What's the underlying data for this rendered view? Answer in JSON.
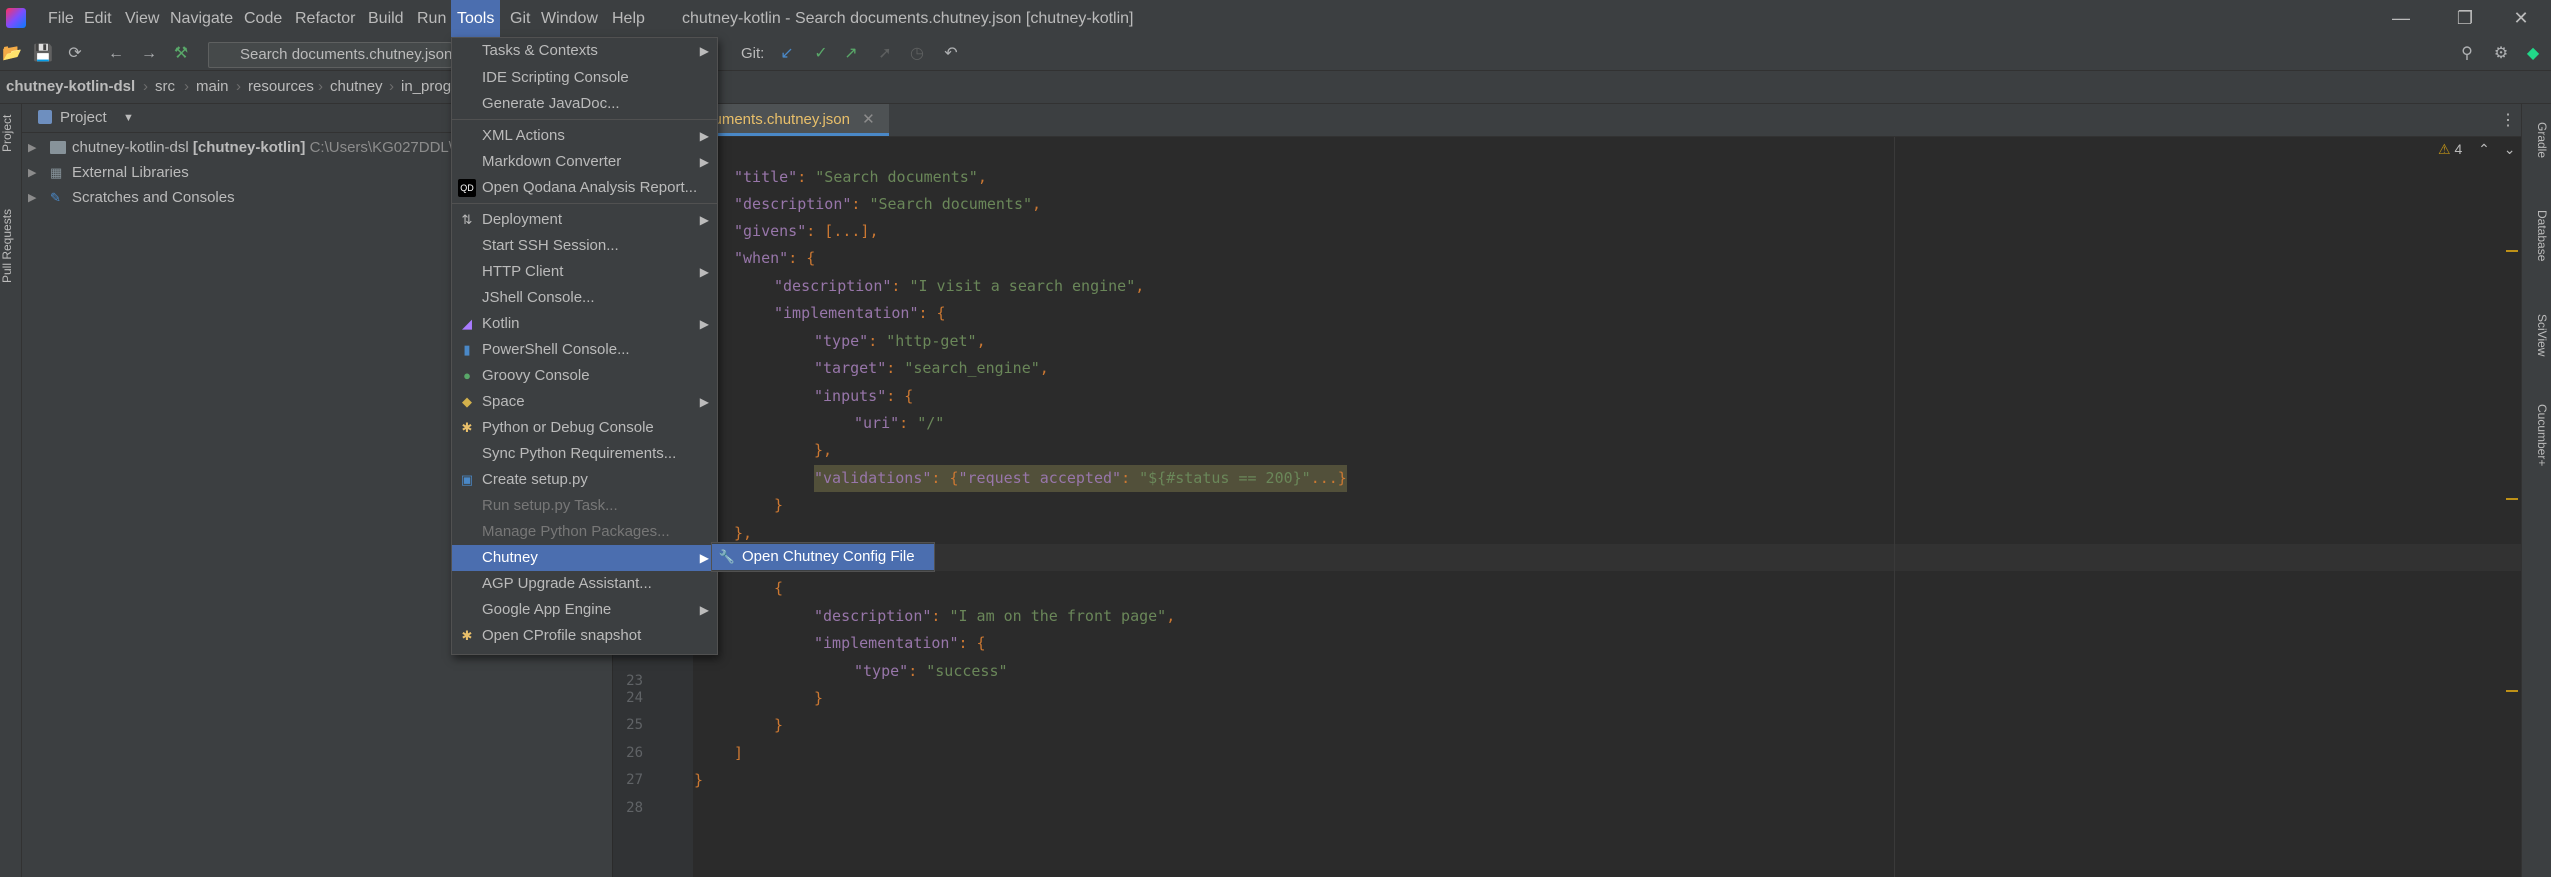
{
  "window": {
    "title": "chutney-kotlin - Search documents.chutney.json [chutney-kotlin]",
    "controls": [
      "—",
      "❐",
      "✕"
    ]
  },
  "menubar": {
    "items": [
      "File",
      "Edit",
      "View",
      "Navigate",
      "Code",
      "Refactor",
      "Build",
      "Run",
      "Tools",
      "Git",
      "Window",
      "Help"
    ],
    "active": "Tools"
  },
  "toolbar": {
    "search_text": "Search documents.chutney.json",
    "git_label": "Git:"
  },
  "breadcrumb": [
    "chutney-kotlin-dsl",
    "src",
    "main",
    "resources",
    "chutney",
    "in_prog"
  ],
  "project": {
    "header": "Project",
    "tree": [
      {
        "label": "chutney-kotlin-dsl",
        "bold_suffix": "[chutney-kotlin]",
        "path": "C:\\Users\\KG027DDL\\"
      },
      {
        "label": "External Libraries"
      },
      {
        "label": "Scratches and Consoles"
      }
    ]
  },
  "left_stripe": [
    "Project",
    "Pull Requests"
  ],
  "right_stripe": [
    "Gradle",
    "Database",
    "SciView",
    "Cucumber+"
  ],
  "editor": {
    "tab": "cuments.chutney.json",
    "warnings": "4",
    "lines": [
      {
        "n": "",
        "text": "\"title\": \"Search documents\","
      },
      {
        "n": "",
        "text": "\"description\": \"Search documents\","
      },
      {
        "n": "",
        "text": "\"givens\": [...],"
      },
      {
        "n": "",
        "text": "\"when\": {"
      },
      {
        "n": "",
        "text": "\"description\": \"I visit a search engine\","
      },
      {
        "n": "",
        "text": "\"implementation\": {"
      },
      {
        "n": "",
        "text": "\"type\": \"http-get\","
      },
      {
        "n": "",
        "text": "\"target\": \"search_engine\","
      },
      {
        "n": "",
        "text": "\"inputs\": {"
      },
      {
        "n": "",
        "text": "\"uri\": \"/\""
      },
      {
        "n": "",
        "text": "},"
      },
      {
        "n": "",
        "text": "\"validations\": {\"request accepted\": \"${#status == 200}\"...}"
      },
      {
        "n": "",
        "text": "}"
      },
      {
        "n": "",
        "text": "},"
      },
      {
        "n": "",
        "text": ""
      },
      {
        "n": "",
        "text": "{"
      },
      {
        "n": "",
        "text": "\"description\": \"I am on the front page\","
      },
      {
        "n": "",
        "text": "\"implementation\": {"
      },
      {
        "n": "23",
        "text": "\"type\": \"success\""
      },
      {
        "n": "24",
        "text": "}"
      },
      {
        "n": "25",
        "text": "}"
      },
      {
        "n": "26",
        "text": "]"
      },
      {
        "n": "27",
        "text": "}"
      },
      {
        "n": "28",
        "text": ""
      }
    ]
  },
  "tools_menu": {
    "items": [
      {
        "label": "Tasks & Contexts",
        "submenu": true
      },
      {
        "label": "IDE Scripting Console"
      },
      {
        "label": "Generate JavaDoc..."
      },
      {
        "label": "XML Actions",
        "submenu": true
      },
      {
        "label": "Markdown Converter",
        "submenu": true
      },
      {
        "label": "Open Qodana Analysis Report..."
      },
      {
        "label": "Deployment",
        "submenu": true
      },
      {
        "label": "Start SSH Session..."
      },
      {
        "label": "HTTP Client",
        "submenu": true
      },
      {
        "label": "JShell Console..."
      },
      {
        "label": "Kotlin",
        "submenu": true
      },
      {
        "label": "PowerShell Console..."
      },
      {
        "label": "Groovy Console"
      },
      {
        "label": "Space",
        "submenu": true
      },
      {
        "label": "Python or Debug Console"
      },
      {
        "label": "Sync Python Requirements..."
      },
      {
        "label": "Create setup.py"
      },
      {
        "label": "Run setup.py Task..."
      },
      {
        "label": "Manage Python Packages..."
      },
      {
        "label": "Chutney",
        "submenu": true
      },
      {
        "label": "AGP Upgrade Assistant..."
      },
      {
        "label": "Google App Engine",
        "submenu": true
      },
      {
        "label": "Open CProfile snapshot"
      }
    ]
  },
  "chutney_submenu": {
    "item": "Open Chutney Config File"
  },
  "colors": {
    "menu_bg": "#3c3f41",
    "selection": "#4b6eaf",
    "editor_bg": "#2b2b2b",
    "string": "#6a8759",
    "key": "#9876aa"
  }
}
